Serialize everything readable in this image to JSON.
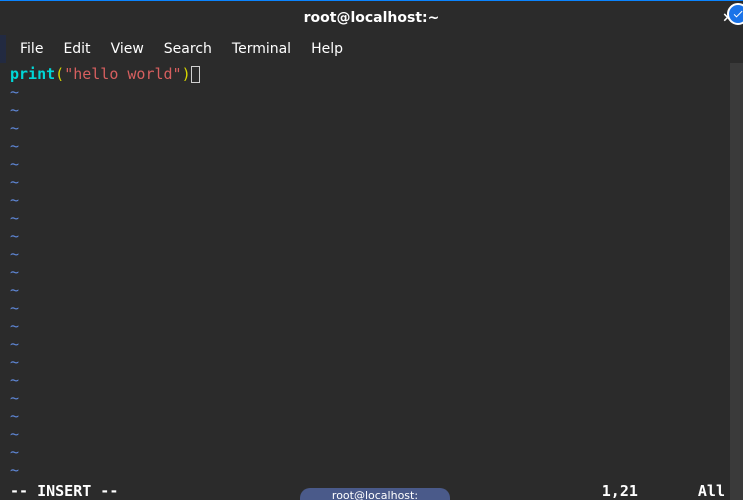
{
  "window": {
    "title": "root@localhost:~",
    "close_glyph": "×"
  },
  "menu": {
    "items": [
      "File",
      "Edit",
      "View",
      "Search",
      "Terminal",
      "Help"
    ]
  },
  "editor": {
    "code": {
      "keyword": "print",
      "open_paren": "(",
      "string": "\"hello world\"",
      "close_paren": ")"
    },
    "empty_line_marker": "~",
    "empty_line_count": 22
  },
  "status": {
    "mode": "-- INSERT --",
    "position": "1,21",
    "scroll": "All"
  },
  "taskbar": {
    "tab_label": "root@localhost:"
  }
}
